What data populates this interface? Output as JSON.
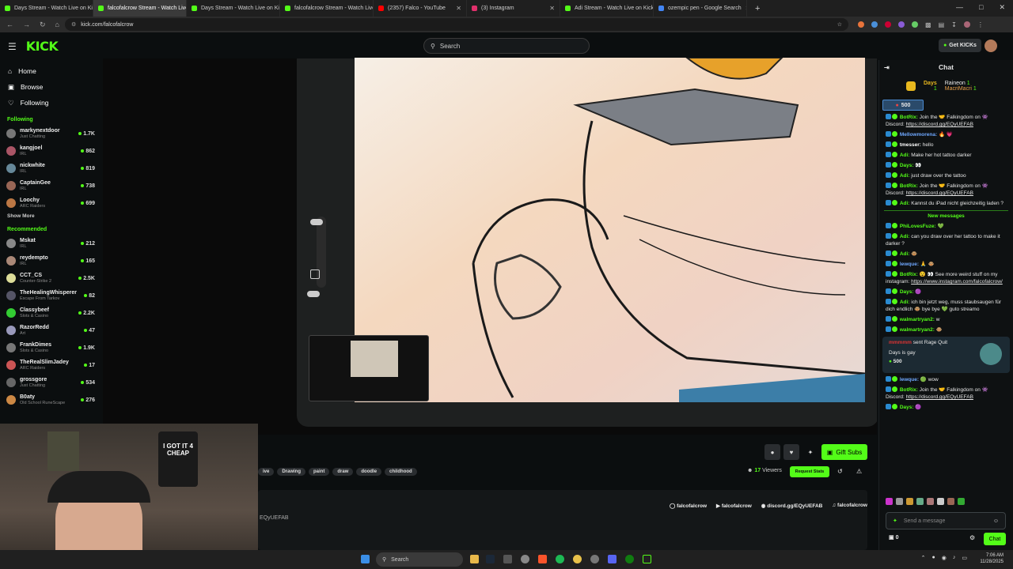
{
  "browser": {
    "tabs": [
      {
        "label": "Days Stream - Watch Live on Kick",
        "color": "#53fc18",
        "active": false
      },
      {
        "label": "falcofalcrow Stream - Watch Live",
        "color": "#53fc18",
        "active": true
      },
      {
        "label": "Days Stream - Watch Live on Kick",
        "color": "#53fc18",
        "active": false
      },
      {
        "label": "falcofalcrow Stream - Watch Live",
        "color": "#53fc18",
        "active": false
      },
      {
        "label": "(2357) Falco - YouTube",
        "color": "#ff0000",
        "active": false
      },
      {
        "label": "(3) Instagram",
        "color": "#e1306c",
        "active": false
      },
      {
        "label": "Adi Stream - Watch Live on Kick",
        "color": "#53fc18",
        "active": false
      },
      {
        "label": "ozempic pen - Google Search",
        "color": "#4285f4",
        "active": false
      }
    ],
    "url": "kick.com/falcofalcrow"
  },
  "header": {
    "logo": "KICK",
    "search_placeholder": "Search",
    "get_kicks": "Get KICKs"
  },
  "sidebar": {
    "nav": [
      "Home",
      "Browse",
      "Following"
    ],
    "following_title": "Following",
    "following": [
      {
        "name": "markynextdoor",
        "category": "Just Chatting",
        "viewers": "1.7K",
        "color": "#777"
      },
      {
        "name": "kangjoel",
        "category": "IRL",
        "viewers": "862",
        "color": "#a56"
      },
      {
        "name": "nickwhite",
        "category": "IRL",
        "viewers": "819",
        "color": "#689"
      },
      {
        "name": "CaptainGee",
        "category": "IRL",
        "viewers": "738",
        "color": "#965"
      },
      {
        "name": "Loochy",
        "category": "ARC Raiders",
        "viewers": "699",
        "color": "#b74"
      }
    ],
    "show_more": "Show More",
    "recommended_title": "Recommended",
    "recommended": [
      {
        "name": "Mskat",
        "category": "IRL",
        "viewers": "212",
        "color": "#888"
      },
      {
        "name": "reydempto",
        "category": "IRL",
        "viewers": "165",
        "color": "#a87"
      },
      {
        "name": "CCT_CS",
        "category": "Counter-Strike 2",
        "viewers": "2.5K",
        "color": "#dd9"
      },
      {
        "name": "TheHealingWhisperer",
        "category": "Escape From Tarkov",
        "viewers": "82",
        "color": "#556"
      },
      {
        "name": "Classybeef",
        "category": "Slots & Casino",
        "viewers": "2.2K",
        "color": "#3c3"
      },
      {
        "name": "RazorRedd",
        "category": "Art",
        "viewers": "47",
        "color": "#99b"
      },
      {
        "name": "FrankDimes",
        "category": "Slots & Casino",
        "viewers": "1.9K",
        "color": "#777"
      },
      {
        "name": "TheRealSlimJadey",
        "category": "ARC Raiders",
        "viewers": "17",
        "color": "#c55"
      },
      {
        "name": "grossgore",
        "category": "Just Chatting",
        "viewers": "534",
        "color": "#666"
      },
      {
        "name": "B0aty",
        "category": "Old School RuneScape",
        "viewers": "276",
        "color": "#c84"
      }
    ]
  },
  "stream": {
    "tags": [
      "ive",
      "Drawing",
      "paint",
      "draw",
      "doodle",
      "childhood"
    ],
    "viewers": "17",
    "viewers_label": "Viewers",
    "gift_subs": "Gift Subs",
    "request_stats": "Request Stats",
    "about_text": "EQyUEFAB",
    "socials": [
      "falcofalcrow",
      "falcofalcrow",
      "discord.gg/EQyUEFAB",
      "falcofalcrow"
    ],
    "webcam_shirt": "I GOT IT 4 CHEAP"
  },
  "chat": {
    "title": "Chat",
    "leaderboard": {
      "label": "Days",
      "count": "1",
      "entries": [
        {
          "name": "Raineon",
          "count": "1"
        },
        {
          "name": "MacriMacri",
          "count": "1"
        }
      ]
    },
    "pinned_amount": "500",
    "messages": [
      {
        "user": "BotRix:",
        "text": "Join the 🤝 Falkingdom on 👾 Discord: ",
        "link": "https://discord.gg/EQyUEFAB",
        "color": "#53fc18"
      },
      {
        "user": "Mellowmorena:",
        "text": "🔥 💗",
        "link": "",
        "color": "#6fa8ff"
      },
      {
        "user": "tmesser:",
        "text": "hello",
        "link": "",
        "color": "#ffffff"
      },
      {
        "user": "Adi:",
        "text": "Make her hot tattoo darker",
        "link": "",
        "color": "#53fc18"
      },
      {
        "user": "Days:",
        "text": "👀",
        "link": "",
        "color": "#53fc18"
      },
      {
        "user": "Adi:",
        "text": "just draw over the tattoo",
        "link": "",
        "color": "#53fc18"
      },
      {
        "user": "BotRix:",
        "text": "Join the 🤝 Falkingdom on 👾 Discord: ",
        "link": "https://discord.gg/EQyUEFAB",
        "color": "#53fc18"
      },
      {
        "user": "Adi:",
        "text": "Kannst du iPad nicht gleichzeitig laden ?",
        "link": "",
        "color": "#53fc18"
      }
    ],
    "new_messages_label": "New messages",
    "messages_new": [
      {
        "user": "PhiLovesFuze:",
        "text": "💚",
        "link": "",
        "color": "#53fc18"
      },
      {
        "user": "Adi:",
        "text": "can you draw over her tattoo to make it darker ?",
        "link": "",
        "color": "#53fc18"
      },
      {
        "user": "Adi:",
        "text": "🐵",
        "link": "",
        "color": "#53fc18"
      },
      {
        "user": "lewque:",
        "text": "🙏 🐵",
        "link": "",
        "color": "#6fa8ff"
      },
      {
        "user": "BotRix:",
        "text": "😵 👀 See more weird stuff on my instagram: ",
        "link": "https://www.instagram.com/falcofalcrow/",
        "color": "#53fc18"
      },
      {
        "user": "Days:",
        "text": "🟣",
        "link": "",
        "color": "#53fc18"
      },
      {
        "user": "Adi:",
        "text": "ich bin jetzt weg, muss staubsaugen für dich endlich 🐵 bye bye 💚 guto streamo",
        "link": "",
        "color": "#53fc18"
      },
      {
        "user": "walmartryan2:",
        "text": "w",
        "link": "",
        "color": "#53fc18"
      },
      {
        "user": "walmartryan2:",
        "text": "🐵",
        "link": "",
        "color": "#53fc18"
      }
    ],
    "gift": {
      "user": "mmmmm",
      "action": "sent Rage Quit",
      "text": "Days is gay",
      "amount": "500"
    },
    "messages_after": [
      {
        "user": "lewque:",
        "text": "🟢 wow",
        "link": "",
        "color": "#6fa8ff"
      },
      {
        "user": "BotRix:",
        "text": "Join the 🤝 Falkingdom on 👾 Discord: ",
        "link": "https://discord.gg/EQyUEFAB",
        "color": "#53fc18"
      },
      {
        "user": "Days:",
        "text": "🟣",
        "link": "",
        "color": "#53fc18"
      }
    ],
    "input_placeholder": "Send a message",
    "kicks_balance": "0",
    "send_label": "Chat"
  },
  "taskbar": {
    "search": "Search",
    "time": "7:06 AM",
    "date": "11/28/2025"
  }
}
